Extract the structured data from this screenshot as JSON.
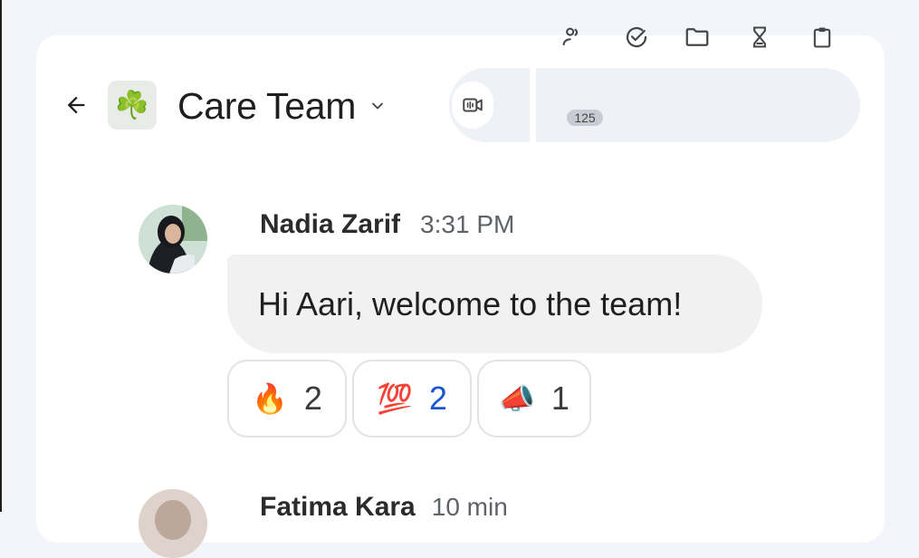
{
  "header": {
    "space_emoji": "☘️",
    "space_name": "Care Team",
    "member_count": "125"
  },
  "icons": {
    "back": "arrow-back-icon",
    "dropdown": "chevron-down-icon",
    "video": "video-call-icon",
    "members": "people-icon",
    "tasks": "task-check-icon",
    "files": "folder-icon",
    "workflow": "hourglass-icon",
    "clipboard": "clipboard-icon"
  },
  "messages": [
    {
      "sender": "Nadia Zarif",
      "time": "3:31 PM",
      "text": "Hi Aari, welcome to the team!",
      "reactions": [
        {
          "emoji": "🔥",
          "count": "2"
        },
        {
          "emoji": "💯",
          "count": "2"
        },
        {
          "emoji": "📣",
          "count": "1"
        }
      ]
    },
    {
      "sender": "Fatima Kara",
      "time": "10 min"
    }
  ],
  "colors": {
    "background": "#f3f5fa",
    "card": "#ffffff",
    "toolbar": "#eef1f6",
    "own_reaction_count": "#1a56d4"
  }
}
